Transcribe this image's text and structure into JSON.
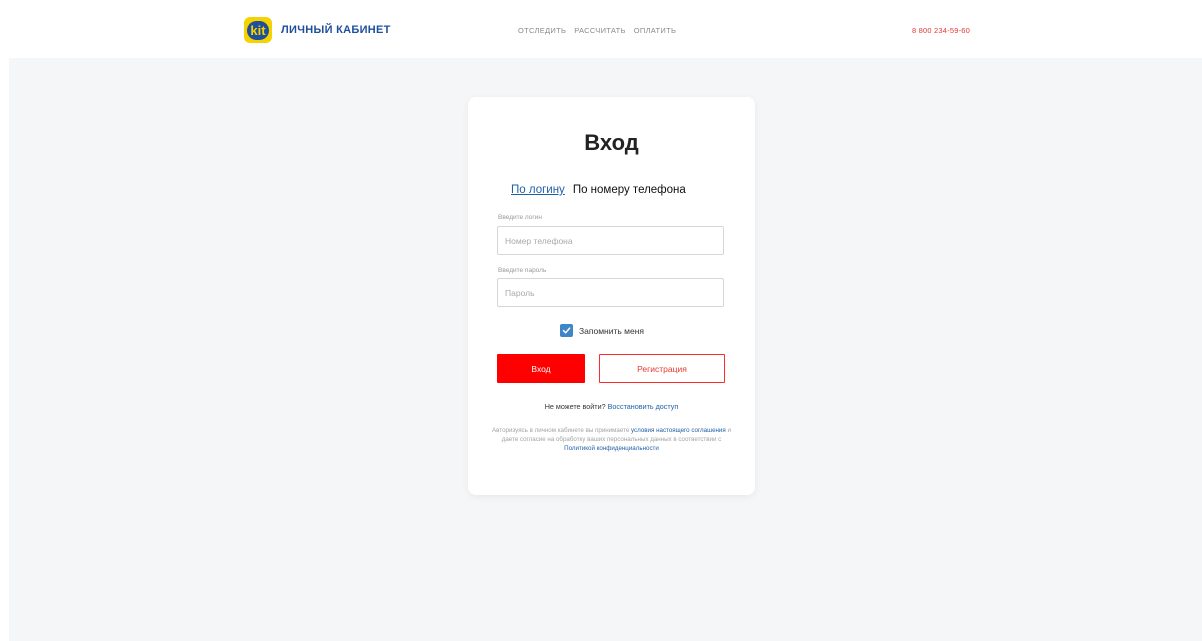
{
  "header": {
    "logo_text": "kit",
    "title": "ЛИЧНЫЙ КАБИНЕТ",
    "nav": [
      "ОТСЛЕДИТЬ",
      "РАССЧИТАТЬ",
      "ОПЛАТИТЬ"
    ],
    "phone": "8 800 234-59-60"
  },
  "login": {
    "title": "Вход",
    "tabs": {
      "login": "По логину",
      "phone": "По номеру телефона"
    },
    "login_label": "Введите логин",
    "login_placeholder": "Номер телефона",
    "login_value": "",
    "password_label": "Введите пароль",
    "password_placeholder": "Пароль",
    "password_value": "",
    "remember_label": "Запомнить меня",
    "remember_checked": true,
    "login_button": "Вход",
    "register_button": "Регистрация",
    "cant_login_text": "Не можете войти?",
    "restore_link": "Восстановить доступ",
    "legal_prefix": "Авторизуясь в личном кабинете вы принимаете",
    "legal_link1": "условия настоящего соглашения",
    "legal_middle": "и даете согласие на обработку ваших персональных данных в соответствии с",
    "legal_link2": "Политикой конфиденциальности"
  },
  "colors": {
    "brand_blue": "#1f4f9c",
    "brand_yellow": "#f5d300",
    "accent_red": "#ff0000",
    "link_blue": "#1f5fa8",
    "checkbox_blue": "#3f86c9",
    "page_bg": "#f5f6f8"
  },
  "icons": {
    "checkbox": "check-icon"
  }
}
